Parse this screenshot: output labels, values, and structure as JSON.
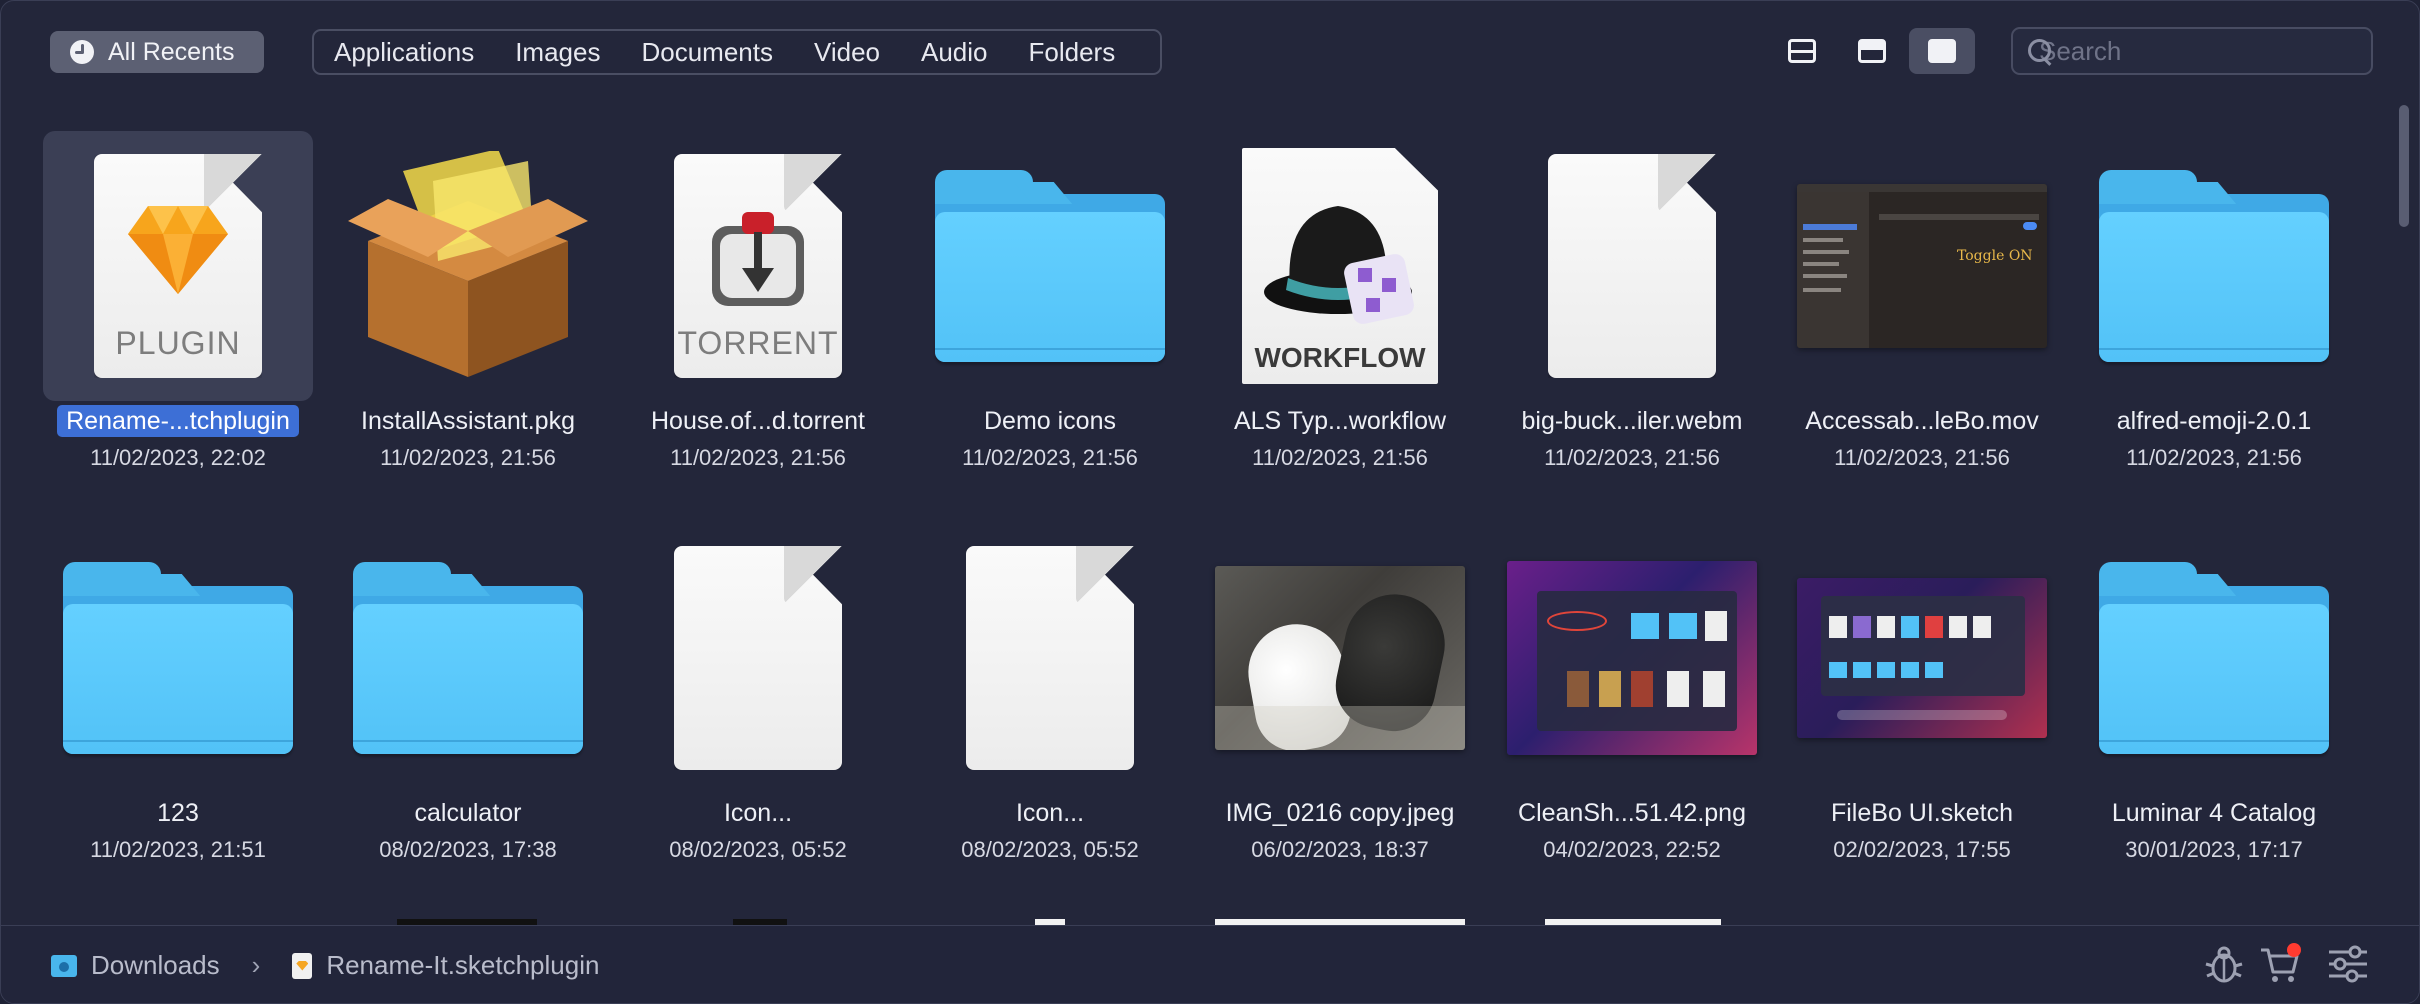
{
  "toolbar": {
    "recents_label": "All Recents",
    "filters": [
      "Applications",
      "Images",
      "Documents",
      "Video",
      "Audio",
      "Folders"
    ],
    "view_modes": [
      "list-view",
      "split-view",
      "icon-view"
    ],
    "active_view": "icon-view",
    "search_placeholder": "Search"
  },
  "files": [
    {
      "name": "Rename-...tchplugin",
      "date": "11/02/2023, 22:02",
      "kind": "plugin",
      "icon_label": "PLUGIN",
      "selected": true
    },
    {
      "name": "InstallAssistant.pkg",
      "date": "11/02/2023, 21:56",
      "kind": "package"
    },
    {
      "name": "House.of...d.torrent",
      "date": "11/02/2023, 21:56",
      "kind": "torrent",
      "icon_label": "TORRENT"
    },
    {
      "name": "Demo icons",
      "date": "11/02/2023, 21:56",
      "kind": "folder"
    },
    {
      "name": "ALS Typ...workflow",
      "date": "11/02/2023, 21:56",
      "kind": "workflow",
      "icon_label": "WORKFLOW"
    },
    {
      "name": "big-buck...iler.webm",
      "date": "11/02/2023, 21:56",
      "kind": "blank-doc"
    },
    {
      "name": "Accessab...leBo.mov",
      "date": "11/02/2023, 21:56",
      "kind": "screenshot-dark",
      "overlay_text": "Toggle ON"
    },
    {
      "name": "alfred-emoji-2.0.1",
      "date": "11/02/2023, 21:56",
      "kind": "folder"
    },
    {
      "name": "123",
      "date": "11/02/2023, 21:51",
      "kind": "folder"
    },
    {
      "name": "calculator",
      "date": "08/02/2023, 17:38",
      "kind": "folder"
    },
    {
      "name": "Icon...",
      "date": "08/02/2023, 05:52",
      "kind": "blank-doc"
    },
    {
      "name": "Icon...",
      "date": "08/02/2023, 05:52",
      "kind": "blank-doc"
    },
    {
      "name": "IMG_0216 copy.jpeg",
      "date": "06/02/2023, 18:37",
      "kind": "photo-mouse"
    },
    {
      "name": "CleanSh...51.42.png",
      "date": "04/02/2023, 22:52",
      "kind": "screenshot-purple"
    },
    {
      "name": "FileBo UI.sketch",
      "date": "02/02/2023, 17:55",
      "kind": "screenshot-purple2"
    },
    {
      "name": "Luminar 4 Catalog",
      "date": "30/01/2023, 17:17",
      "kind": "folder"
    }
  ],
  "statusbar": {
    "breadcrumb": [
      "Downloads",
      "Rename-It.sketchplugin"
    ],
    "icons": [
      "bug-icon",
      "cart-icon",
      "settings-sliders-icon"
    ],
    "cart_badge_color": "#ff3b30"
  },
  "colors": {
    "background": "#23263a",
    "folder_blue": "#52c2f7",
    "selection_blue": "#3d6fd6"
  }
}
